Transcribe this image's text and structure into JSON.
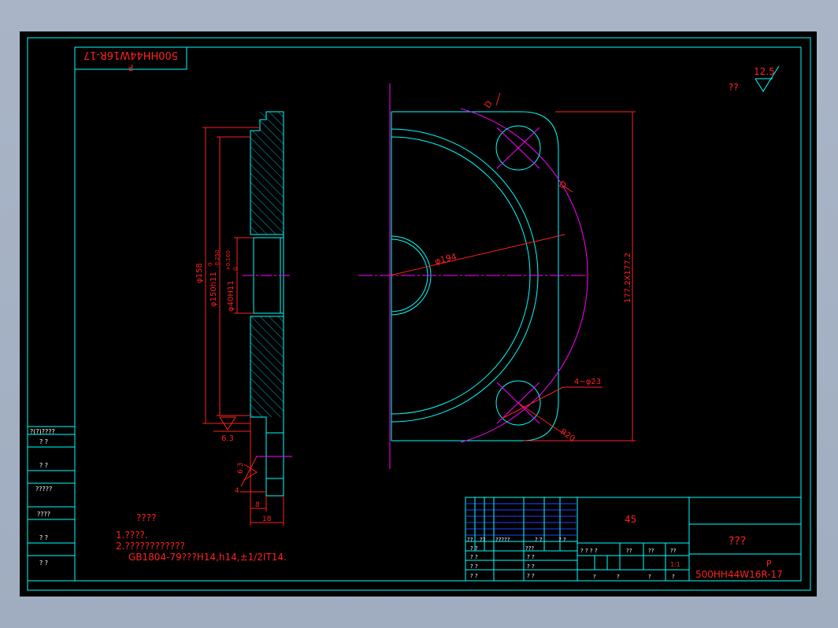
{
  "colors": {
    "background": "#000000",
    "frame": "#00ffff",
    "dimension": "#ff2020",
    "centerline": "#ff00ff",
    "title_text": "#ff2020"
  },
  "drawing": {
    "top_left_code_p": "P",
    "top_left_code": "500HH44W16R-17",
    "surface_finish_prefix": "??",
    "surface_finish_value": "12.5",
    "dims": {
      "d158": "φ158",
      "d150": "φ150h11",
      "d150_tol_upper": "0",
      "d150_tol_lower": "-0.250",
      "d40": "φ40H11",
      "d40_tol_upper": "+0.160",
      "d40_tol_lower": "0",
      "rough_63_a": "6.3",
      "rough_63_b": "6.3",
      "dim_4": "4",
      "dim_8": "8",
      "dim_18": "18",
      "d194": "φ194",
      "square": "177.2X177.2",
      "holes": "4~φ23",
      "r20": "R20",
      "d_label_1": "D",
      "d_label_2": "D"
    },
    "notes": {
      "heading": "????",
      "line1": "1.????.",
      "line2": "2.????????????",
      "line3": "GB1804-79???H14,h14,±1/2IT14."
    },
    "side_table": [
      "?(?)????",
      "?   ?",
      "?   ?",
      "?????",
      "????",
      "?   ?",
      "?   ?"
    ],
    "title_block": {
      "material": "45",
      "name": "???",
      "code_p": "P",
      "code": "500HH44W16R-17",
      "scale": "1:1",
      "row_labels_a": [
        "??",
        "??",
        "?????",
        "? ?",
        "? ?"
      ],
      "sign_labels": [
        "? ?",
        "? ?",
        "? ?",
        "? ?"
      ],
      "sign_labels_b": [
        "???",
        "? ?",
        "? ?",
        "? ?"
      ],
      "stage_labels": [
        "? ? ? ?",
        "??",
        "??",
        "??"
      ],
      "bottom_labels": [
        "?",
        "?",
        "?",
        "?"
      ]
    }
  }
}
